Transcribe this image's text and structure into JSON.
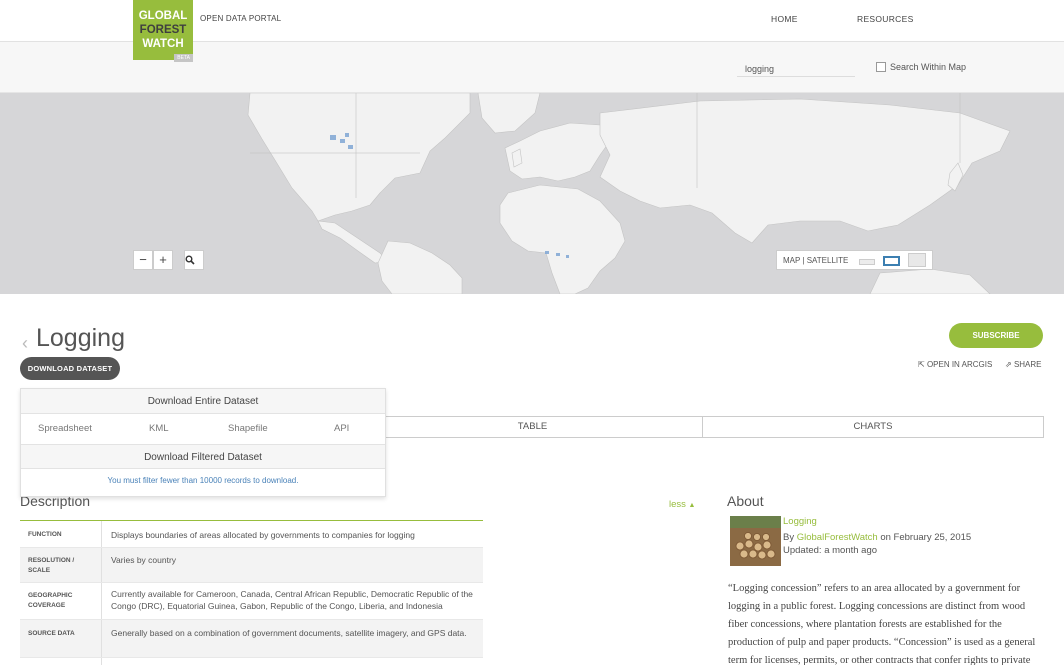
{
  "header": {
    "logo": {
      "line1": "GLOBAL",
      "line2": "FOREST",
      "line3": "WATCH",
      "beta": "BETA"
    },
    "portal_label": "OPEN DATA PORTAL",
    "nav": {
      "home": "HOME",
      "resources": "RESOURCES"
    }
  },
  "search": {
    "value": "logging",
    "within_map_label": "Search Within Map",
    "within_map_checked": false
  },
  "map": {
    "zoom_out": "−",
    "zoom_in": "+",
    "search_icon": "magnifier-icon",
    "basemap_label": "MAP | SATELLITE"
  },
  "dataset": {
    "title": "Logging",
    "download_button": "DOWNLOAD DATASET",
    "subscribe": "SUBSCRIBE",
    "open_in_arcgis": "OPEN IN ARCGIS",
    "share": "SHARE"
  },
  "tabs": [
    "TABLE",
    "CHARTS"
  ],
  "download_menu": {
    "entire_heading": "Download Entire Dataset",
    "options": [
      "Spreadsheet",
      "KML",
      "Shapefile",
      "API"
    ],
    "filtered_heading": "Download Filtered Dataset",
    "filtered_note": "You must filter fewer than 10000 records to download."
  },
  "description": {
    "title": "Description",
    "toggle": "less",
    "rows": [
      {
        "key": "FUNCTION",
        "value": "Displays boundaries of areas allocated by governments to companies for logging"
      },
      {
        "key": "RESOLUTION / SCALE",
        "value": "Varies by country"
      },
      {
        "key": "GEOGRAPHIC COVERAGE",
        "value": "Currently available for Cameroon, Canada, Central African Republic, Democratic Republic of the Congo (DRC), Equatorial Guinea, Gabon, Republic of the Congo, Liberia, and Indonesia"
      },
      {
        "key": "SOURCE DATA",
        "value": "Generally based on a combination of government documents, satellite imagery, and GPS data."
      }
    ]
  },
  "about": {
    "title": "About",
    "item_title": "Logging",
    "by_prefix": "By",
    "owner": "GlobalForestWatch",
    "date_text": "on February 25, 2015",
    "updated": "Updated: a month ago",
    "text": "“Logging concession” refers to an area allocated by a government for logging in a public forest. Logging concessions are distinct from wood fiber concessions, where plantation forests are established for the production of pulp and paper products. “Concession” is used as a general term for licenses, permits, or other contracts that confer rights to private"
  },
  "colors": {
    "accent": "#97bd3d",
    "dark_button": "#555555",
    "map_bg": "#d6d6d8",
    "land": "#f2f2f2",
    "link_blue": "#4a82b8"
  }
}
